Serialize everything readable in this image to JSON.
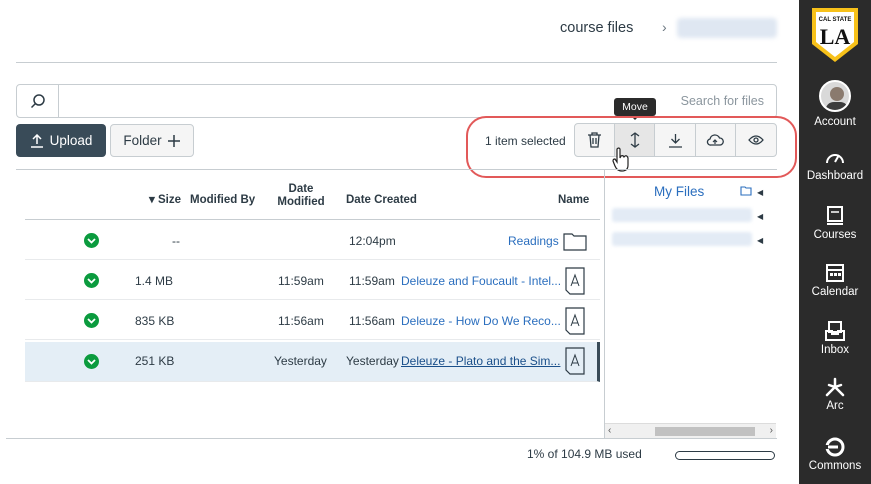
{
  "header": {
    "breadcrumb_current": "course files",
    "breadcrumb_separator": "›"
  },
  "search": {
    "placeholder": "Search for files"
  },
  "toolbar": {
    "upload_label": "Upload",
    "folder_label": "Folder",
    "selection_status": "1 item selected",
    "tooltip": "Move"
  },
  "tree": {
    "root_label": "My Files"
  },
  "table": {
    "headers": {
      "name": "Name",
      "date_created": "Date Created",
      "date_modified_line1": "Date",
      "date_modified_line2": "Modified",
      "modified_by": "Modified By",
      "size": "Size"
    },
    "rows": [
      {
        "type": "folder",
        "name": "Readings",
        "created": "12:04pm",
        "modified": "",
        "size": "--",
        "selected": false
      },
      {
        "type": "pdf",
        "name": "Deleuze and Foucault - Intel...",
        "created": "11:59am",
        "modified": "11:59am",
        "size": "1.4 MB",
        "selected": false
      },
      {
        "type": "pdf",
        "name": "Deleuze - How Do We Reco...",
        "created": "11:56am",
        "modified": "11:56am",
        "size": "835 KB",
        "selected": false
      },
      {
        "type": "pdf",
        "name": "Deleuze - Plato and the Sim...",
        "created": "Yesterday",
        "modified": "Yesterday",
        "size": "251 KB",
        "selected": true
      }
    ]
  },
  "footer": {
    "quota_text": "1% of 104.9 MB used",
    "quota_percent": 1
  },
  "global_nav": {
    "logo_top": "CAL STATE",
    "logo_main": "LA",
    "items": [
      {
        "label": "Account",
        "icon": "avatar"
      },
      {
        "label": "Dashboard",
        "icon": "dashboard-icon"
      },
      {
        "label": "Courses",
        "icon": "courses-icon"
      },
      {
        "label": "Calendar",
        "icon": "calendar-icon"
      },
      {
        "label": "Inbox",
        "icon": "inbox-icon"
      },
      {
        "label": "Arc",
        "icon": "arc-icon"
      },
      {
        "label": "Commons",
        "icon": "commons-icon"
      }
    ]
  },
  "colors": {
    "nav_bg": "#2b2b2b",
    "primary_button": "#394b58",
    "link": "#2a6ebe",
    "status_green": "#0b9b3e",
    "highlight_oval": "#e25959",
    "selected_row": "#e4eef6"
  }
}
